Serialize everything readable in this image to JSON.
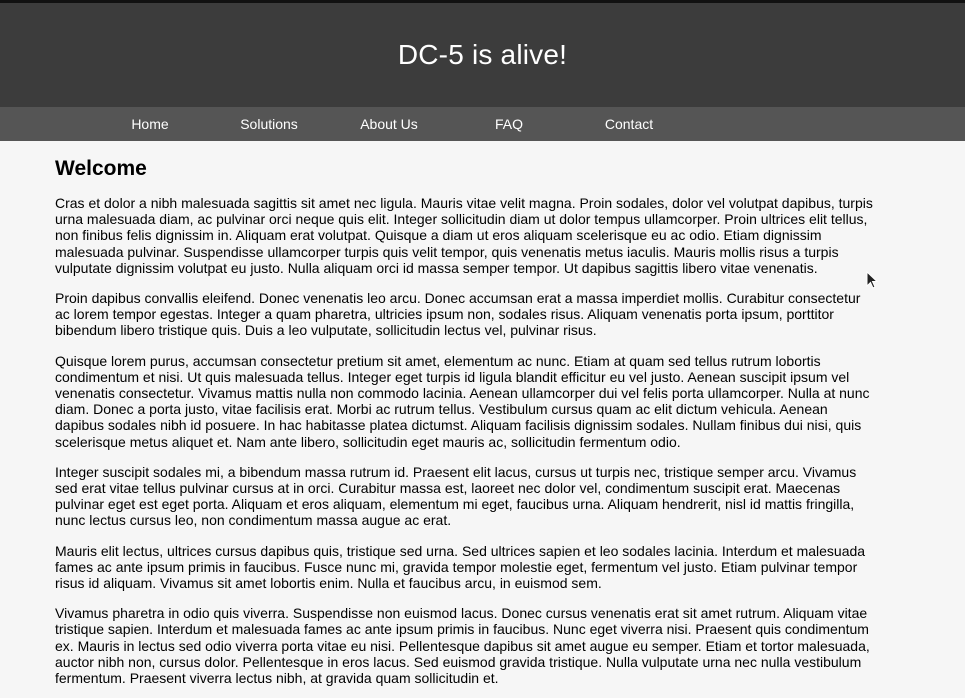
{
  "header": {
    "title": "DC-5 is alive!"
  },
  "nav": {
    "items": [
      {
        "label": "Home"
      },
      {
        "label": "Solutions"
      },
      {
        "label": "About Us"
      },
      {
        "label": "FAQ"
      },
      {
        "label": "Contact"
      }
    ]
  },
  "main": {
    "heading": "Welcome",
    "paragraphs": [
      "Cras et dolor a nibh malesuada sagittis sit amet nec ligula. Mauris vitae velit magna. Proin sodales, dolor vel volutpat dapibus, turpis urna malesuada diam, ac pulvinar orci neque quis elit. Integer sollicitudin diam ut dolor tempus ullamcorper. Proin ultrices elit tellus, non finibus felis dignissim in. Aliquam erat volutpat. Quisque a diam ut eros aliquam scelerisque eu ac odio. Etiam dignissim malesuada pulvinar. Suspendisse ullamcorper turpis quis velit tempor, quis venenatis metus iaculis. Mauris mollis risus a turpis vulputate dignissim volutpat eu justo. Nulla aliquam orci id massa semper tempor. Ut dapibus sagittis libero vitae venenatis.",
      "Proin dapibus convallis eleifend. Donec venenatis leo arcu. Donec accumsan erat a massa imperdiet mollis. Curabitur consectetur ac lorem tempor egestas. Integer a quam pharetra, ultricies ipsum non, sodales risus. Aliquam venenatis porta ipsum, porttitor bibendum libero tristique quis. Duis a leo vulputate, sollicitudin lectus vel, pulvinar risus.",
      "Quisque lorem purus, accumsan consectetur pretium sit amet, elementum ac nunc. Etiam at quam sed tellus rutrum lobortis condimentum et nisi. Ut quis malesuada tellus. Integer eget turpis id ligula blandit efficitur eu vel justo. Aenean suscipit ipsum vel venenatis consectetur. Vivamus mattis nulla non commodo lacinia. Aenean ullamcorper dui vel felis porta ullamcorper. Nulla at nunc diam. Donec a porta justo, vitae facilisis erat. Morbi ac rutrum tellus. Vestibulum cursus quam ac elit dictum vehicula. Aenean dapibus sodales nibh id posuere. In hac habitasse platea dictumst. Aliquam facilisis dignissim sodales. Nullam finibus dui nisi, quis scelerisque metus aliquet et. Nam ante libero, sollicitudin eget mauris ac, sollicitudin fermentum odio.",
      "Integer suscipit sodales mi, a bibendum massa rutrum id. Praesent elit lacus, cursus ut turpis nec, tristique semper arcu. Vivamus sed erat vitae tellus pulvinar cursus at in orci. Curabitur massa est, laoreet nec dolor vel, condimentum suscipit erat. Maecenas pulvinar eget est eget porta. Aliquam et eros aliquam, elementum mi eget, faucibus urna. Aliquam hendrerit, nisl id mattis fringilla, nunc lectus cursus leo, non condimentum massa augue ac erat.",
      "Mauris elit lectus, ultrices cursus dapibus quis, tristique sed urna. Sed ultrices sapien et leo sodales lacinia. Interdum et malesuada fames ac ante ipsum primis in faucibus. Fusce nunc mi, gravida tempor molestie eget, fermentum vel justo. Etiam pulvinar tempor risus id aliquam. Vivamus sit amet lobortis enim. Nulla et faucibus arcu, in euismod sem.",
      "Vivamus pharetra in odio quis viverra. Suspendisse non euismod lacus. Donec cursus venenatis erat sit amet rutrum. Aliquam vitae tristique sapien. Interdum et malesuada fames ac ante ipsum primis in faucibus. Nunc eget viverra nisi. Praesent quis condimentum ex. Mauris in lectus sed odio viverra porta vitae eu nisi. Pellentesque dapibus sit amet augue eu semper. Etiam et tortor malesuada, auctor nibh non, cursus dolor. Pellentesque in eros lacus. Sed euismod gravida tristique. Nulla vulputate urna nec nulla vestibulum fermentum. Praesent viverra lectus nibh, at gravida quam sollicitudin et."
    ]
  },
  "icons": {
    "cursor": "mouse-pointer-icon"
  },
  "colors": {
    "header_bg": "#3c3c3c",
    "nav_bg": "#555555",
    "page_bg": "#f6f6f6",
    "text": "#000000",
    "nav_text": "#ffffff"
  }
}
